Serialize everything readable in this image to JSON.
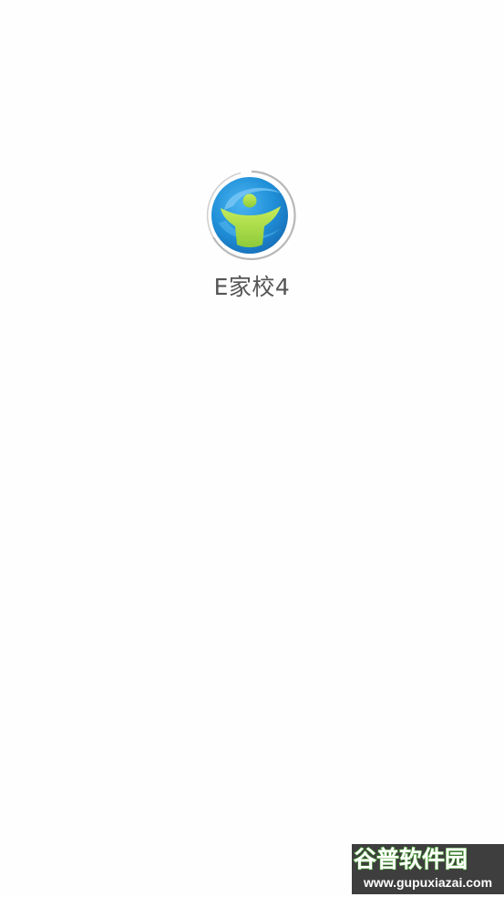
{
  "app": {
    "name": "E家校4",
    "logo_icon": "egoschool-person-logo-icon"
  },
  "colors": {
    "background": "#fefefe",
    "logo_blue": "#1f8fd8",
    "logo_green": "#a9d84a",
    "text": "#555555"
  },
  "watermark": {
    "logo_text": "谷普软件园",
    "url": "www.gupuxiazai.com"
  }
}
